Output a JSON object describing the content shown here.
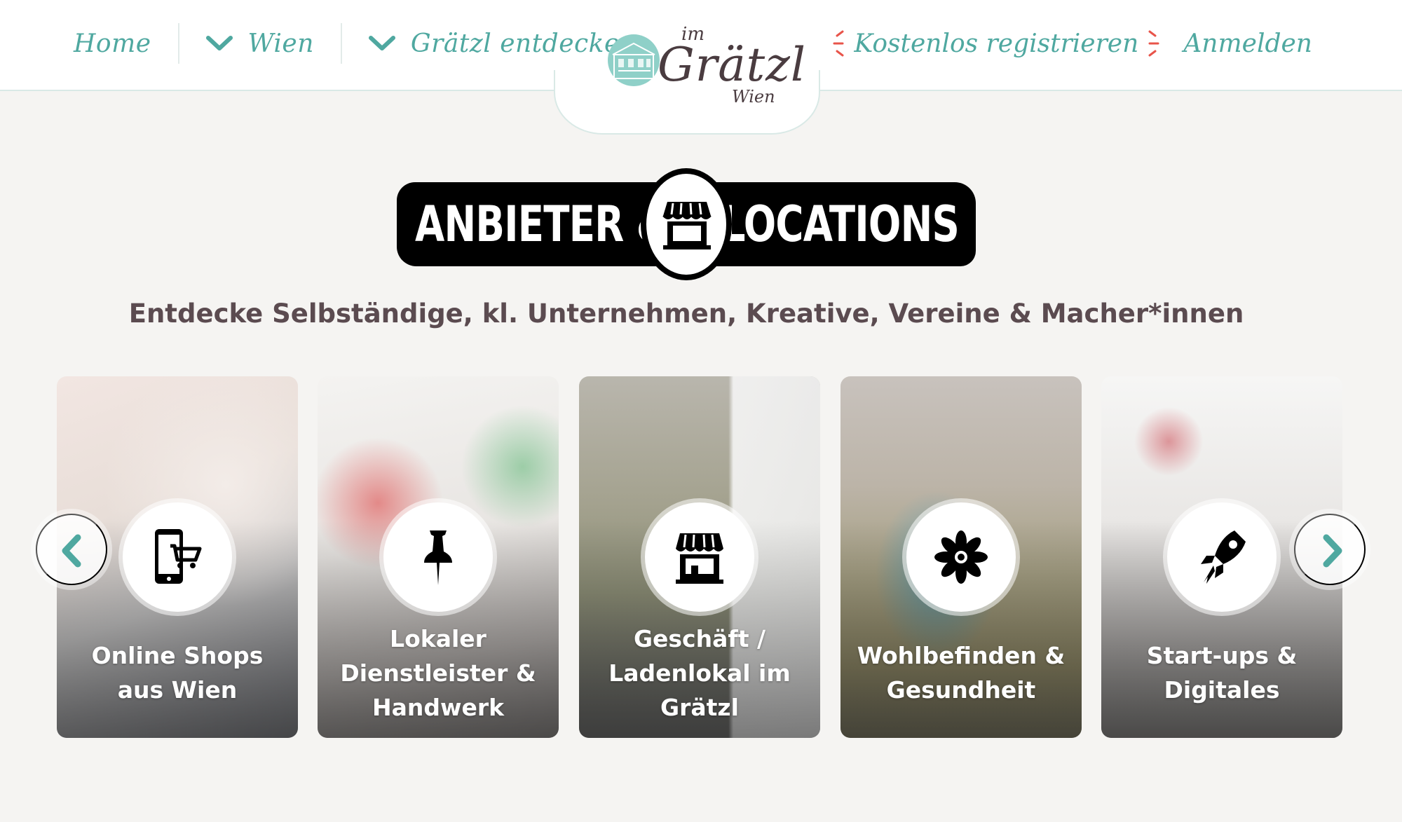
{
  "header": {
    "nav": {
      "home": "Home",
      "city": "Wien",
      "discover": "Grätzl entdecken"
    },
    "register": "Kostenlos registrieren",
    "login": "Anmelden",
    "logo": {
      "prefix": "im",
      "name": "Grätzl",
      "city": "Wien"
    }
  },
  "hero": {
    "title_left": "ANBIETER &",
    "title_right": "LOCATIONS",
    "title_icon": "storefront-icon",
    "subtitle": "Entdecke Selbständige, kl. Unternehmen, Kreative, Vereine & Macher*innen"
  },
  "categories": [
    {
      "label": "Online Shops\naus Wien",
      "icon": "mobile-shopping-icon"
    },
    {
      "label": "Lokaler\nDienstleister &\nHandwerk",
      "icon": "pushpin-icon"
    },
    {
      "label": "Geschäft /\nLadenlokal im\nGrätzl",
      "icon": "storefront-icon"
    },
    {
      "label": "Wohlbefinden &\nGesundheit",
      "icon": "lotus-flower-icon"
    },
    {
      "label": "Start-ups &\nDigitales",
      "icon": "rocket-icon"
    }
  ],
  "carousel": {
    "prev_icon": "chevron-left-icon",
    "next_icon": "chevron-right-icon"
  },
  "colors": {
    "accent": "#4fa8a0",
    "register_accent": "#e8544a",
    "text": "#5b4b50",
    "background": "#f5f4f2"
  }
}
